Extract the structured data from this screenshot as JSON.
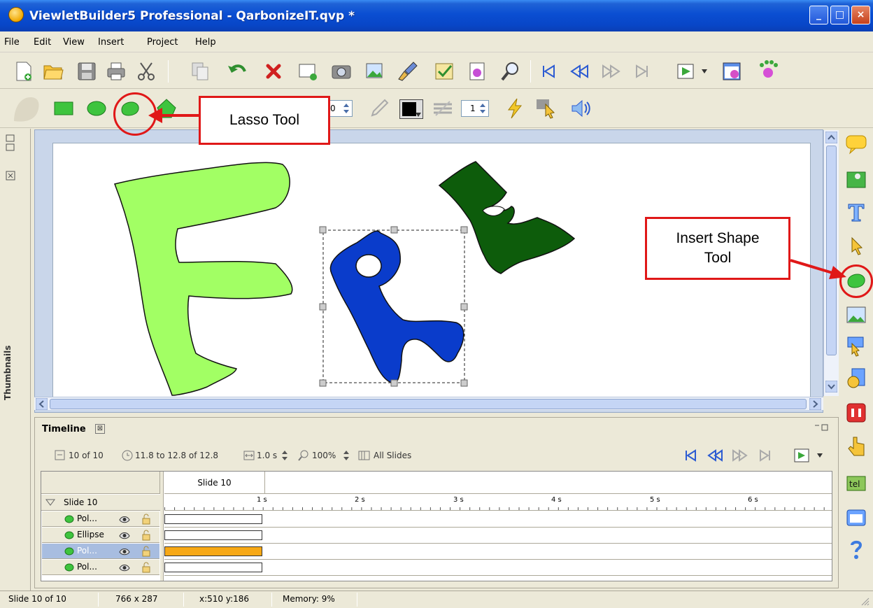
{
  "window": {
    "title": "ViewletBuilder5 Professional - QarbonizeIT.qvp *",
    "buttons": {
      "minimize": "_",
      "maximize": "□",
      "close": "×"
    }
  },
  "menu": [
    "File",
    "Edit",
    "View",
    "Insert",
    "Project",
    "Help"
  ],
  "toolbar2": {
    "fontsize_value": "0",
    "linewidth_value": "1"
  },
  "annotations": {
    "lasso_tool": "Lasso Tool",
    "insert_shape_tool_line1": "Insert Shape",
    "insert_shape_tool_line2": "Tool"
  },
  "sidebar": {
    "thumbnails_label": "Thumbnails"
  },
  "timeline": {
    "title": "Timeline",
    "close": "⊠",
    "slide_count": "10 of 10",
    "time_range": "11.8 to 12.8 of 12.8",
    "duration": "1.0 s",
    "zoom": "100%",
    "all_slides": "All Slides",
    "tab_label": "Slide 10",
    "tree_root": "Slide 10",
    "ruler": [
      "1 s",
      "2 s",
      "3 s",
      "4 s",
      "5 s",
      "6 s"
    ],
    "layers": [
      {
        "name": "Pol...",
        "selected": false
      },
      {
        "name": "Ellipse",
        "selected": false
      },
      {
        "name": "Pol...",
        "selected": true
      },
      {
        "name": "Pol...",
        "selected": false
      }
    ]
  },
  "status": {
    "slide": "Slide 10 of 10",
    "size": "766 x 287",
    "coords": "x:510 y:186",
    "memory": "Memory: 9%"
  },
  "colors": {
    "accent_red": "#e01818",
    "letter_f": "#a2ff64",
    "letter_r": "#0a3ccb",
    "letter_e": "#0d5c0b",
    "selected_bar": "#f7a814"
  }
}
